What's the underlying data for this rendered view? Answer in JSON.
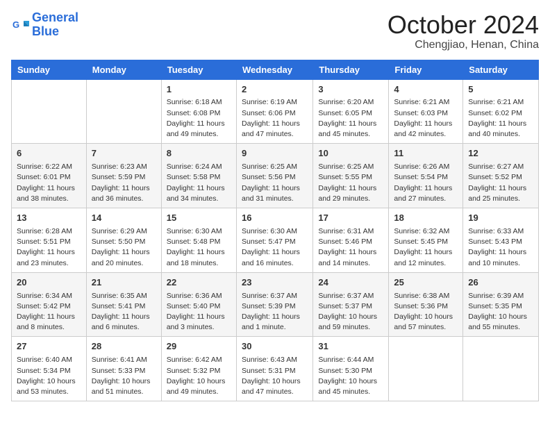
{
  "header": {
    "logo_line1": "General",
    "logo_line2": "Blue",
    "month": "October 2024",
    "location": "Chengjiao, Henan, China"
  },
  "weekdays": [
    "Sunday",
    "Monday",
    "Tuesday",
    "Wednesday",
    "Thursday",
    "Friday",
    "Saturday"
  ],
  "weeks": [
    [
      {
        "day": null
      },
      {
        "day": null
      },
      {
        "day": "1",
        "sunrise": "Sunrise: 6:18 AM",
        "sunset": "Sunset: 6:08 PM",
        "daylight": "Daylight: 11 hours and 49 minutes."
      },
      {
        "day": "2",
        "sunrise": "Sunrise: 6:19 AM",
        "sunset": "Sunset: 6:06 PM",
        "daylight": "Daylight: 11 hours and 47 minutes."
      },
      {
        "day": "3",
        "sunrise": "Sunrise: 6:20 AM",
        "sunset": "Sunset: 6:05 PM",
        "daylight": "Daylight: 11 hours and 45 minutes."
      },
      {
        "day": "4",
        "sunrise": "Sunrise: 6:21 AM",
        "sunset": "Sunset: 6:03 PM",
        "daylight": "Daylight: 11 hours and 42 minutes."
      },
      {
        "day": "5",
        "sunrise": "Sunrise: 6:21 AM",
        "sunset": "Sunset: 6:02 PM",
        "daylight": "Daylight: 11 hours and 40 minutes."
      }
    ],
    [
      {
        "day": "6",
        "sunrise": "Sunrise: 6:22 AM",
        "sunset": "Sunset: 6:01 PM",
        "daylight": "Daylight: 11 hours and 38 minutes."
      },
      {
        "day": "7",
        "sunrise": "Sunrise: 6:23 AM",
        "sunset": "Sunset: 5:59 PM",
        "daylight": "Daylight: 11 hours and 36 minutes."
      },
      {
        "day": "8",
        "sunrise": "Sunrise: 6:24 AM",
        "sunset": "Sunset: 5:58 PM",
        "daylight": "Daylight: 11 hours and 34 minutes."
      },
      {
        "day": "9",
        "sunrise": "Sunrise: 6:25 AM",
        "sunset": "Sunset: 5:56 PM",
        "daylight": "Daylight: 11 hours and 31 minutes."
      },
      {
        "day": "10",
        "sunrise": "Sunrise: 6:25 AM",
        "sunset": "Sunset: 5:55 PM",
        "daylight": "Daylight: 11 hours and 29 minutes."
      },
      {
        "day": "11",
        "sunrise": "Sunrise: 6:26 AM",
        "sunset": "Sunset: 5:54 PM",
        "daylight": "Daylight: 11 hours and 27 minutes."
      },
      {
        "day": "12",
        "sunrise": "Sunrise: 6:27 AM",
        "sunset": "Sunset: 5:52 PM",
        "daylight": "Daylight: 11 hours and 25 minutes."
      }
    ],
    [
      {
        "day": "13",
        "sunrise": "Sunrise: 6:28 AM",
        "sunset": "Sunset: 5:51 PM",
        "daylight": "Daylight: 11 hours and 23 minutes."
      },
      {
        "day": "14",
        "sunrise": "Sunrise: 6:29 AM",
        "sunset": "Sunset: 5:50 PM",
        "daylight": "Daylight: 11 hours and 20 minutes."
      },
      {
        "day": "15",
        "sunrise": "Sunrise: 6:30 AM",
        "sunset": "Sunset: 5:48 PM",
        "daylight": "Daylight: 11 hours and 18 minutes."
      },
      {
        "day": "16",
        "sunrise": "Sunrise: 6:30 AM",
        "sunset": "Sunset: 5:47 PM",
        "daylight": "Daylight: 11 hours and 16 minutes."
      },
      {
        "day": "17",
        "sunrise": "Sunrise: 6:31 AM",
        "sunset": "Sunset: 5:46 PM",
        "daylight": "Daylight: 11 hours and 14 minutes."
      },
      {
        "day": "18",
        "sunrise": "Sunrise: 6:32 AM",
        "sunset": "Sunset: 5:45 PM",
        "daylight": "Daylight: 11 hours and 12 minutes."
      },
      {
        "day": "19",
        "sunrise": "Sunrise: 6:33 AM",
        "sunset": "Sunset: 5:43 PM",
        "daylight": "Daylight: 11 hours and 10 minutes."
      }
    ],
    [
      {
        "day": "20",
        "sunrise": "Sunrise: 6:34 AM",
        "sunset": "Sunset: 5:42 PM",
        "daylight": "Daylight: 11 hours and 8 minutes."
      },
      {
        "day": "21",
        "sunrise": "Sunrise: 6:35 AM",
        "sunset": "Sunset: 5:41 PM",
        "daylight": "Daylight: 11 hours and 6 minutes."
      },
      {
        "day": "22",
        "sunrise": "Sunrise: 6:36 AM",
        "sunset": "Sunset: 5:40 PM",
        "daylight": "Daylight: 11 hours and 3 minutes."
      },
      {
        "day": "23",
        "sunrise": "Sunrise: 6:37 AM",
        "sunset": "Sunset: 5:39 PM",
        "daylight": "Daylight: 11 hours and 1 minute."
      },
      {
        "day": "24",
        "sunrise": "Sunrise: 6:37 AM",
        "sunset": "Sunset: 5:37 PM",
        "daylight": "Daylight: 10 hours and 59 minutes."
      },
      {
        "day": "25",
        "sunrise": "Sunrise: 6:38 AM",
        "sunset": "Sunset: 5:36 PM",
        "daylight": "Daylight: 10 hours and 57 minutes."
      },
      {
        "day": "26",
        "sunrise": "Sunrise: 6:39 AM",
        "sunset": "Sunset: 5:35 PM",
        "daylight": "Daylight: 10 hours and 55 minutes."
      }
    ],
    [
      {
        "day": "27",
        "sunrise": "Sunrise: 6:40 AM",
        "sunset": "Sunset: 5:34 PM",
        "daylight": "Daylight: 10 hours and 53 minutes."
      },
      {
        "day": "28",
        "sunrise": "Sunrise: 6:41 AM",
        "sunset": "Sunset: 5:33 PM",
        "daylight": "Daylight: 10 hours and 51 minutes."
      },
      {
        "day": "29",
        "sunrise": "Sunrise: 6:42 AM",
        "sunset": "Sunset: 5:32 PM",
        "daylight": "Daylight: 10 hours and 49 minutes."
      },
      {
        "day": "30",
        "sunrise": "Sunrise: 6:43 AM",
        "sunset": "Sunset: 5:31 PM",
        "daylight": "Daylight: 10 hours and 47 minutes."
      },
      {
        "day": "31",
        "sunrise": "Sunrise: 6:44 AM",
        "sunset": "Sunset: 5:30 PM",
        "daylight": "Daylight: 10 hours and 45 minutes."
      },
      {
        "day": null
      },
      {
        "day": null
      }
    ]
  ]
}
